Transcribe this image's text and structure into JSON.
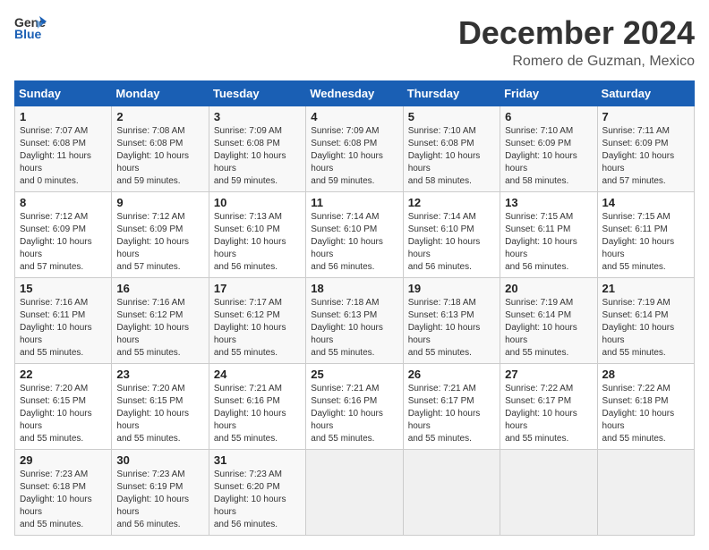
{
  "header": {
    "logo_line1": "General",
    "logo_line2": "Blue",
    "month_title": "December 2024",
    "subtitle": "Romero de Guzman, Mexico"
  },
  "days_of_week": [
    "Sunday",
    "Monday",
    "Tuesday",
    "Wednesday",
    "Thursday",
    "Friday",
    "Saturday"
  ],
  "weeks": [
    [
      {
        "day": "1",
        "sunrise": "7:07 AM",
        "sunset": "6:08 PM",
        "daylight": "11 hours and 0 minutes."
      },
      {
        "day": "2",
        "sunrise": "7:08 AM",
        "sunset": "6:08 PM",
        "daylight": "10 hours and 59 minutes."
      },
      {
        "day": "3",
        "sunrise": "7:09 AM",
        "sunset": "6:08 PM",
        "daylight": "10 hours and 59 minutes."
      },
      {
        "day": "4",
        "sunrise": "7:09 AM",
        "sunset": "6:08 PM",
        "daylight": "10 hours and 59 minutes."
      },
      {
        "day": "5",
        "sunrise": "7:10 AM",
        "sunset": "6:08 PM",
        "daylight": "10 hours and 58 minutes."
      },
      {
        "day": "6",
        "sunrise": "7:10 AM",
        "sunset": "6:09 PM",
        "daylight": "10 hours and 58 minutes."
      },
      {
        "day": "7",
        "sunrise": "7:11 AM",
        "sunset": "6:09 PM",
        "daylight": "10 hours and 57 minutes."
      }
    ],
    [
      {
        "day": "8",
        "sunrise": "7:12 AM",
        "sunset": "6:09 PM",
        "daylight": "10 hours and 57 minutes."
      },
      {
        "day": "9",
        "sunrise": "7:12 AM",
        "sunset": "6:09 PM",
        "daylight": "10 hours and 57 minutes."
      },
      {
        "day": "10",
        "sunrise": "7:13 AM",
        "sunset": "6:10 PM",
        "daylight": "10 hours and 56 minutes."
      },
      {
        "day": "11",
        "sunrise": "7:14 AM",
        "sunset": "6:10 PM",
        "daylight": "10 hours and 56 minutes."
      },
      {
        "day": "12",
        "sunrise": "7:14 AM",
        "sunset": "6:10 PM",
        "daylight": "10 hours and 56 minutes."
      },
      {
        "day": "13",
        "sunrise": "7:15 AM",
        "sunset": "6:11 PM",
        "daylight": "10 hours and 56 minutes."
      },
      {
        "day": "14",
        "sunrise": "7:15 AM",
        "sunset": "6:11 PM",
        "daylight": "10 hours and 55 minutes."
      }
    ],
    [
      {
        "day": "15",
        "sunrise": "7:16 AM",
        "sunset": "6:11 PM",
        "daylight": "10 hours and 55 minutes."
      },
      {
        "day": "16",
        "sunrise": "7:16 AM",
        "sunset": "6:12 PM",
        "daylight": "10 hours and 55 minutes."
      },
      {
        "day": "17",
        "sunrise": "7:17 AM",
        "sunset": "6:12 PM",
        "daylight": "10 hours and 55 minutes."
      },
      {
        "day": "18",
        "sunrise": "7:18 AM",
        "sunset": "6:13 PM",
        "daylight": "10 hours and 55 minutes."
      },
      {
        "day": "19",
        "sunrise": "7:18 AM",
        "sunset": "6:13 PM",
        "daylight": "10 hours and 55 minutes."
      },
      {
        "day": "20",
        "sunrise": "7:19 AM",
        "sunset": "6:14 PM",
        "daylight": "10 hours and 55 minutes."
      },
      {
        "day": "21",
        "sunrise": "7:19 AM",
        "sunset": "6:14 PM",
        "daylight": "10 hours and 55 minutes."
      }
    ],
    [
      {
        "day": "22",
        "sunrise": "7:20 AM",
        "sunset": "6:15 PM",
        "daylight": "10 hours and 55 minutes."
      },
      {
        "day": "23",
        "sunrise": "7:20 AM",
        "sunset": "6:15 PM",
        "daylight": "10 hours and 55 minutes."
      },
      {
        "day": "24",
        "sunrise": "7:21 AM",
        "sunset": "6:16 PM",
        "daylight": "10 hours and 55 minutes."
      },
      {
        "day": "25",
        "sunrise": "7:21 AM",
        "sunset": "6:16 PM",
        "daylight": "10 hours and 55 minutes."
      },
      {
        "day": "26",
        "sunrise": "7:21 AM",
        "sunset": "6:17 PM",
        "daylight": "10 hours and 55 minutes."
      },
      {
        "day": "27",
        "sunrise": "7:22 AM",
        "sunset": "6:17 PM",
        "daylight": "10 hours and 55 minutes."
      },
      {
        "day": "28",
        "sunrise": "7:22 AM",
        "sunset": "6:18 PM",
        "daylight": "10 hours and 55 minutes."
      }
    ],
    [
      {
        "day": "29",
        "sunrise": "7:23 AM",
        "sunset": "6:18 PM",
        "daylight": "10 hours and 55 minutes."
      },
      {
        "day": "30",
        "sunrise": "7:23 AM",
        "sunset": "6:19 PM",
        "daylight": "10 hours and 56 minutes."
      },
      {
        "day": "31",
        "sunrise": "7:23 AM",
        "sunset": "6:20 PM",
        "daylight": "10 hours and 56 minutes."
      },
      null,
      null,
      null,
      null
    ]
  ],
  "labels": {
    "sunrise": "Sunrise:",
    "sunset": "Sunset:",
    "daylight": "Daylight:"
  }
}
